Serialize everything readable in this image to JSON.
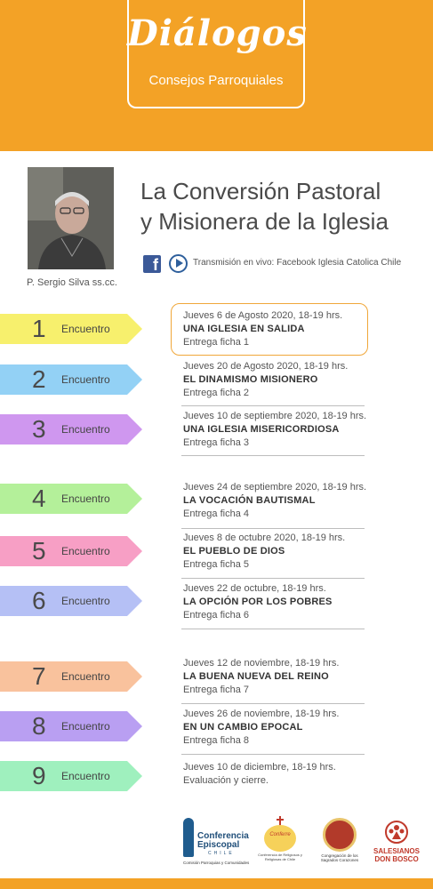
{
  "header": {
    "title": "Diálogos",
    "subtitle": "Consejos Parroquiales"
  },
  "speaker": {
    "caption": "P. Sergio Silva ss.cc."
  },
  "main_title": {
    "line1": "La Conversión Pastoral",
    "line2": "y Misionera de la Iglesia"
  },
  "broadcast": {
    "text": "Transmisión en vivo: Facebook Iglesia Catolica Chile",
    "facebook_icon_letter": "f"
  },
  "encounters": [
    {
      "num": "1",
      "label": "Encuentro",
      "color": "#f7f06d",
      "date": "Jueves 6 de Agosto 2020, 18-19 hrs.",
      "topic": "UNA IGLESIA EN SALIDA",
      "note": "Entrega ficha 1"
    },
    {
      "num": "2",
      "label": "Encuentro",
      "color": "#93d1f5",
      "date": "Jueves 20 de Agosto 2020, 18-19 hrs.",
      "topic": "EL DINAMISMO MISIONERO",
      "note": "Entrega ficha 2"
    },
    {
      "num": "3",
      "label": "Encuentro",
      "color": "#cf97ef",
      "date": "Jueves 10 de septiembre 2020, 18-19 hrs.",
      "topic": "UNA IGLESIA MISERICORDIOSA",
      "note": "Entrega ficha 3"
    },
    {
      "num": "4",
      "label": "Encuentro",
      "color": "#b4f09a",
      "date": "Jueves 24 de septiembre 2020, 18-19 hrs.",
      "topic": "LA VOCACIÓN BAUTISMAL",
      "note": "Entrega ficha 4"
    },
    {
      "num": "5",
      "label": "Encuentro",
      "color": "#f79fc5",
      "date": "Jueves 8 de octubre 2020, 18-19 hrs.",
      "topic": "EL PUEBLO DE DIOS",
      "note": "Entrega ficha 5"
    },
    {
      "num": "6",
      "label": "Encuentro",
      "color": "#b5c0f5",
      "date": "Jueves 22 de octubre,  18-19 hrs.",
      "topic": "LA OPCIÓN POR LOS POBRES",
      "note": "Entrega ficha 6"
    },
    {
      "num": "7",
      "label": "Encuentro",
      "color": "#f9c29d",
      "date": "Jueves 12 de noviembre, 18-19 hrs.",
      "topic": "LA BUENA NUEVA DEL REINO",
      "note": "Entrega ficha 7"
    },
    {
      "num": "8",
      "label": "Encuentro",
      "color": "#b99ff2",
      "date": "Jueves  26 de noviembre, 18-19 hrs.",
      "topic": "EN UN CAMBIO EPOCAL",
      "note": "Entrega ficha 8"
    },
    {
      "num": "9",
      "label": "Encuentro",
      "color": "#9ff0be",
      "date": "Jueves 10 de diciembre, 18-19 hrs.",
      "topic": "",
      "note": "Evaluación y cierre."
    }
  ],
  "logos": {
    "conferencia": {
      "line1": "Conferencia",
      "line2": "Episcopal",
      "line3": "CHILE",
      "line4": "Comisión Parroquias y Comunidades"
    },
    "conferre": {
      "name": "Conferre",
      "caption": "Conferencia de Religiosos y Religiosas de Chile"
    },
    "sscc": {
      "caption": "Congregación de los Sagrados Corazones"
    },
    "salesianos": {
      "line1": "SALESIANOS",
      "line2": "DON BOSCO"
    }
  },
  "colors": {
    "brand_orange": "#f3a226",
    "highlight_border": "#f0a73a"
  }
}
